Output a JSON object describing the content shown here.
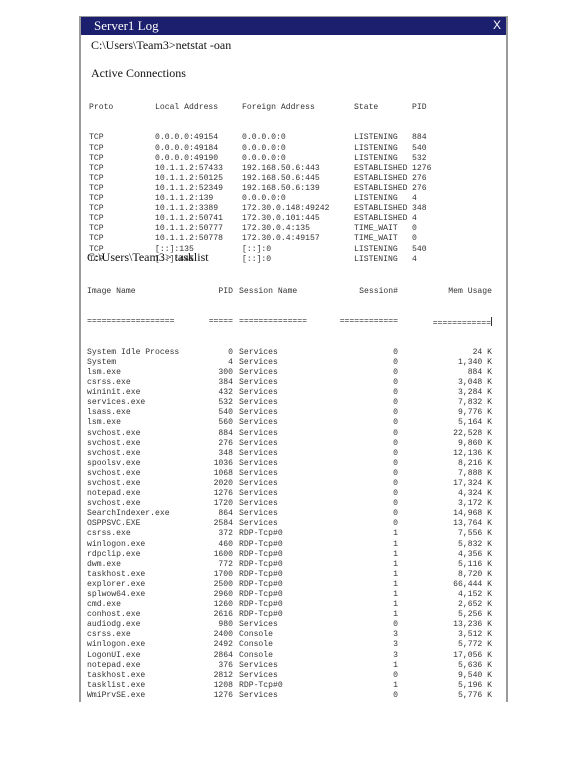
{
  "window": {
    "title": "Server1 Log",
    "close_label": "X",
    "title_bar_color": "#1c1f6e"
  },
  "netstat": {
    "command": "C:\\Users\\Team3>netstat -oan",
    "section_title": "Active Connections",
    "columns": [
      "Proto",
      "Local Address",
      "Foreign Address",
      "State",
      "PID"
    ],
    "rows": [
      [
        "TCP",
        "0.0.0.0:49154",
        "0.0.0.0:0",
        "LISTENING",
        "884"
      ],
      [
        "TCP",
        "0.0.0.0:49184",
        "0.0.0.0:0",
        "LISTENING",
        "540"
      ],
      [
        "TCP",
        "0.0.0.0:49190",
        "0.0.0.0:0",
        "LISTENING",
        "532"
      ],
      [
        "TCP",
        "10.1.1.2:57433",
        "192.168.50.6:443",
        "ESTABLISHED",
        "1276"
      ],
      [
        "TCP",
        "10.1.1.2:50125",
        "192.168.50.6:445",
        "ESTABLISHED",
        "276"
      ],
      [
        "TCP",
        "10.1.1.2:52349",
        "192.168.50.6:139",
        "ESTABLISHED",
        "276"
      ],
      [
        "TCP",
        "10.1.1.2:139",
        "0.0.0.0:0",
        "LISTENING",
        "4"
      ],
      [
        "TCP",
        "10.1.1.2:3389",
        "172.30.0.148:49242",
        "ESTABLISHED",
        "348"
      ],
      [
        "TCP",
        "10.1.1.2:50741",
        "172.30.0.101:445",
        "ESTABLISHED",
        "4"
      ],
      [
        "TCP",
        "10.1.1.2:50777",
        "172.30.0.4:135",
        "TIME_WAIT",
        "0"
      ],
      [
        "TCP",
        "10.1.1.2:50778",
        "172.30.0.4:49157",
        "TIME_WAIT",
        "0"
      ],
      [
        "TCP",
        "[::]:135",
        "[::]:0",
        "LISTENING",
        "540"
      ],
      [
        "TCP",
        "[::]:445",
        "[::]:0",
        "LISTENING",
        "4"
      ]
    ]
  },
  "tasklist": {
    "command": "C:\\Users\\Team3> tasklist",
    "columns": [
      "Image Name",
      "PID",
      "Session Name",
      "Session#",
      "Mem Usage"
    ],
    "separators": [
      "==================",
      "=====",
      "==============",
      "============",
      "============"
    ],
    "rows": [
      [
        "System Idle Process",
        "0",
        "Services",
        "0",
        "24 K"
      ],
      [
        "System",
        "4",
        "Services",
        "0",
        "1,340 K"
      ],
      [
        "lsm.exe",
        "300",
        "Services",
        "0",
        "884 K"
      ],
      [
        "csrss.exe",
        "384",
        "Services",
        "0",
        "3,048 K"
      ],
      [
        "wininit.exe",
        "432",
        "Services",
        "0",
        "3,284 K"
      ],
      [
        "services.exe",
        "532",
        "Services",
        "0",
        "7,832 K"
      ],
      [
        "lsass.exe",
        "540",
        "Services",
        "0",
        "9,776 K"
      ],
      [
        "lsm.exe",
        "560",
        "Services",
        "0",
        "5,164 K"
      ],
      [
        "svchost.exe",
        "884",
        "Services",
        "0",
        "22,528 K"
      ],
      [
        "svchost.exe",
        "276",
        "Services",
        "0",
        "9,860 K"
      ],
      [
        "svchost.exe",
        "348",
        "Services",
        "0",
        "12,136 K"
      ],
      [
        "spoolsv.exe",
        "1036",
        "Services",
        "0",
        "8,216 K"
      ],
      [
        "svchost.exe",
        "1068",
        "Services",
        "0",
        "7,888 K"
      ],
      [
        "svchost.exe",
        "2020",
        "Services",
        "0",
        "17,324 K"
      ],
      [
        "notepad.exe",
        "1276",
        "Services",
        "0",
        "4,324 K"
      ],
      [
        "svchost.exe",
        "1720",
        "Services",
        "0",
        "3,172 K"
      ],
      [
        "SearchIndexer.exe",
        "864",
        "Services",
        "0",
        "14,968 K"
      ],
      [
        "OSPPSVC.EXE",
        "2584",
        "Services",
        "0",
        "13,764 K"
      ],
      [
        "csrss.exe",
        "372",
        "RDP-Tcp#0",
        "1",
        "7,556 K"
      ],
      [
        "winlogon.exe",
        "460",
        "RDP-Tcp#0",
        "1",
        "5,832 K"
      ],
      [
        "rdpclip.exe",
        "1600",
        "RDP-Tcp#0",
        "1",
        "4,356 K"
      ],
      [
        "dwm.exe",
        "772",
        "RDP-Tcp#0",
        "1",
        "5,116 K"
      ],
      [
        "taskhost.exe",
        "1700",
        "RDP-Tcp#0",
        "1",
        "8,720 K"
      ],
      [
        "explorer.exe",
        "2500",
        "RDP-Tcp#0",
        "1",
        "66,444 K"
      ],
      [
        "splwow64.exe",
        "2960",
        "RDP-Tcp#0",
        "1",
        "4,152 K"
      ],
      [
        "cmd.exe",
        "1260",
        "RDP-Tcp#0",
        "1",
        "2,652 K"
      ],
      [
        "conhost.exe",
        "2616",
        "RDP-Tcp#0",
        "1",
        "5,256 K"
      ],
      [
        "audiodg.exe",
        "980",
        "Services",
        "0",
        "13,236 K"
      ],
      [
        "csrss.exe",
        "2400",
        "Console",
        "3",
        "3,512 K"
      ],
      [
        "winlogon.exe",
        "2492",
        "Console",
        "3",
        "5,772 K"
      ],
      [
        "LogonUI.exe",
        "2864",
        "Console",
        "3",
        "17,056 K"
      ],
      [
        "notepad.exe",
        "376",
        "Services",
        "1",
        "5,636 K"
      ],
      [
        "taskhost.exe",
        "2812",
        "Services",
        "0",
        "9,540 K"
      ],
      [
        "tasklist.exe",
        "1208",
        "RDP-Tcp#0",
        "1",
        "5,196 K"
      ],
      [
        "WmiPrvSE.exe",
        "1276",
        "Services",
        "0",
        "5,776 K"
      ]
    ]
  }
}
